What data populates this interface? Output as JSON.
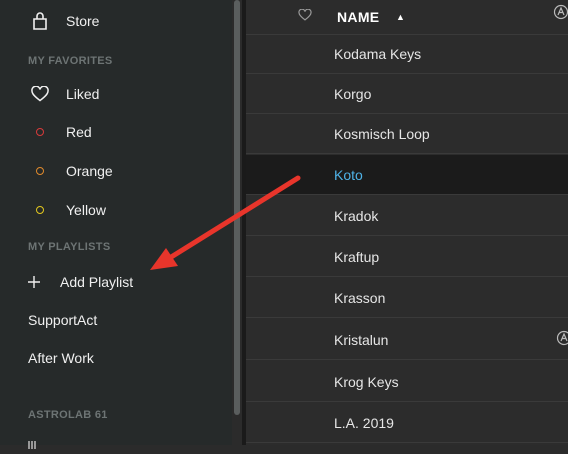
{
  "sidebar": {
    "store_label": "Store",
    "favorites_header": "MY FAVORITES",
    "favorites": [
      {
        "label": "Liked",
        "icon": "heart-icon"
      },
      {
        "label": "Red",
        "icon": "circle-icon",
        "color": "#d83b3b"
      },
      {
        "label": "Orange",
        "icon": "circle-icon",
        "color": "#e08a2c"
      },
      {
        "label": "Yellow",
        "icon": "circle-icon",
        "color": "#e3c81e"
      }
    ],
    "playlists_header": "MY PLAYLISTS",
    "add_playlist_label": "Add Playlist",
    "playlists": [
      "SupportAct",
      "After Work"
    ],
    "device_header": "ASTROLAB 61"
  },
  "list": {
    "column_name": "NAME",
    "sort_glyph": "▲",
    "rows": [
      "Kodama Keys",
      "Korgo",
      "Kosmisch Loop",
      "Koto",
      "Kradok",
      "Kraftup",
      "Krasson",
      "Kristalun",
      "Krog Keys",
      "L.A. 2019"
    ],
    "selected_row": "Koto"
  },
  "colors": {
    "accent": "#4fb3e8",
    "arrow": "#e8352b"
  }
}
